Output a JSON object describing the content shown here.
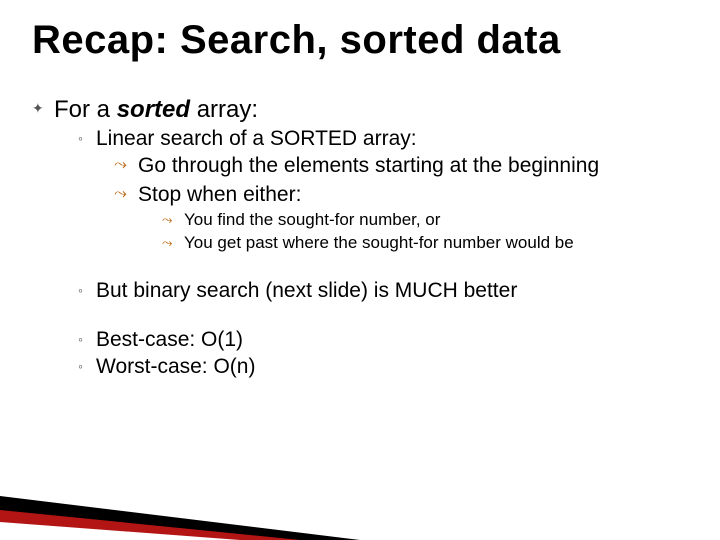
{
  "title": "Recap:  Search, sorted data",
  "bullets": {
    "top_prefix": "For a ",
    "top_italic": "sorted ",
    "top_suffix": " array:",
    "sub1": "Linear search of a SORTED array:",
    "sub1a": "Go through the elements starting at the beginning",
    "sub1b": "Stop when either:",
    "sub1b_i": "You find the sought-for number, or",
    "sub1b_ii": "You get past where the sought-for number would be",
    "sub2": "But binary search (next slide) is MUCH better",
    "sub3": "Best-case:  O(1)",
    "sub4": "Worst-case: O(n)"
  },
  "icons": {
    "bullet0": "✦",
    "bullet1": "◦",
    "bullet2": "⤳",
    "bullet3": "⤳"
  }
}
